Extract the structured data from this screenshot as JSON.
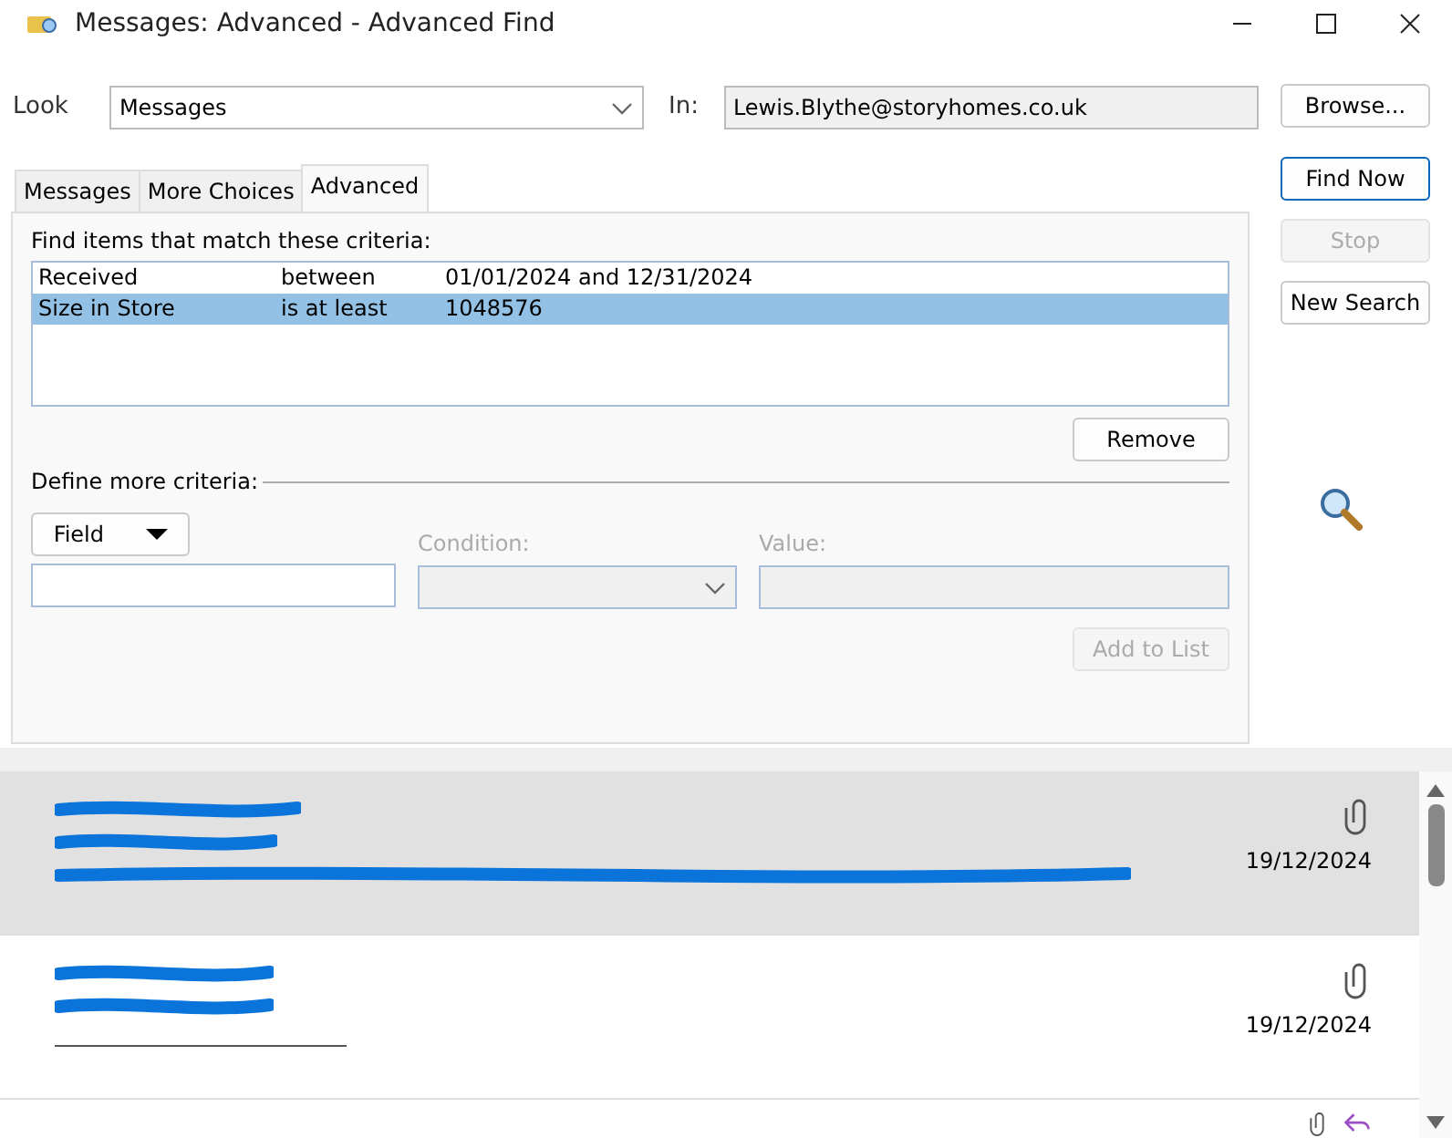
{
  "window": {
    "title": "Messages: Advanced - Advanced Find"
  },
  "look": {
    "label": "Look",
    "value": "Messages",
    "in_label": "In:",
    "in_value": "Lewis.Blythe@storyhomes.co.uk",
    "browse": "Browse..."
  },
  "tabs": [
    {
      "label": "Messages",
      "selected": false
    },
    {
      "label": "More Choices",
      "selected": false
    },
    {
      "label": "Advanced",
      "selected": true
    }
  ],
  "criteria": {
    "heading": "Find items that match these criteria:",
    "rows": [
      {
        "field": "Received",
        "condition": "between",
        "value": "01/01/2024 and 12/31/2024",
        "selected": false
      },
      {
        "field": "Size in Store",
        "condition": "is at least",
        "value": "1048576",
        "selected": true
      }
    ],
    "remove": "Remove"
  },
  "define": {
    "heading": "Define more criteria:",
    "field_button": "Field",
    "condition_label": "Condition:",
    "value_label": "Value:",
    "add": "Add to List"
  },
  "buttons": [
    {
      "label": "Find Now",
      "disabled": false,
      "default": true
    },
    {
      "label": "Stop",
      "disabled": true,
      "default": false
    },
    {
      "label": "New Search",
      "disabled": false,
      "default": false
    }
  ],
  "results": [
    {
      "kind": "preview",
      "date": "19/12/2024",
      "selected": true,
      "attachment": true,
      "replied": false
    },
    {
      "kind": "compact",
      "date": "19/12/2024",
      "selected": false,
      "attachment": true,
      "replied": false
    },
    {
      "kind": "clipped",
      "selected": false,
      "attachment": true,
      "replied": true
    }
  ]
}
